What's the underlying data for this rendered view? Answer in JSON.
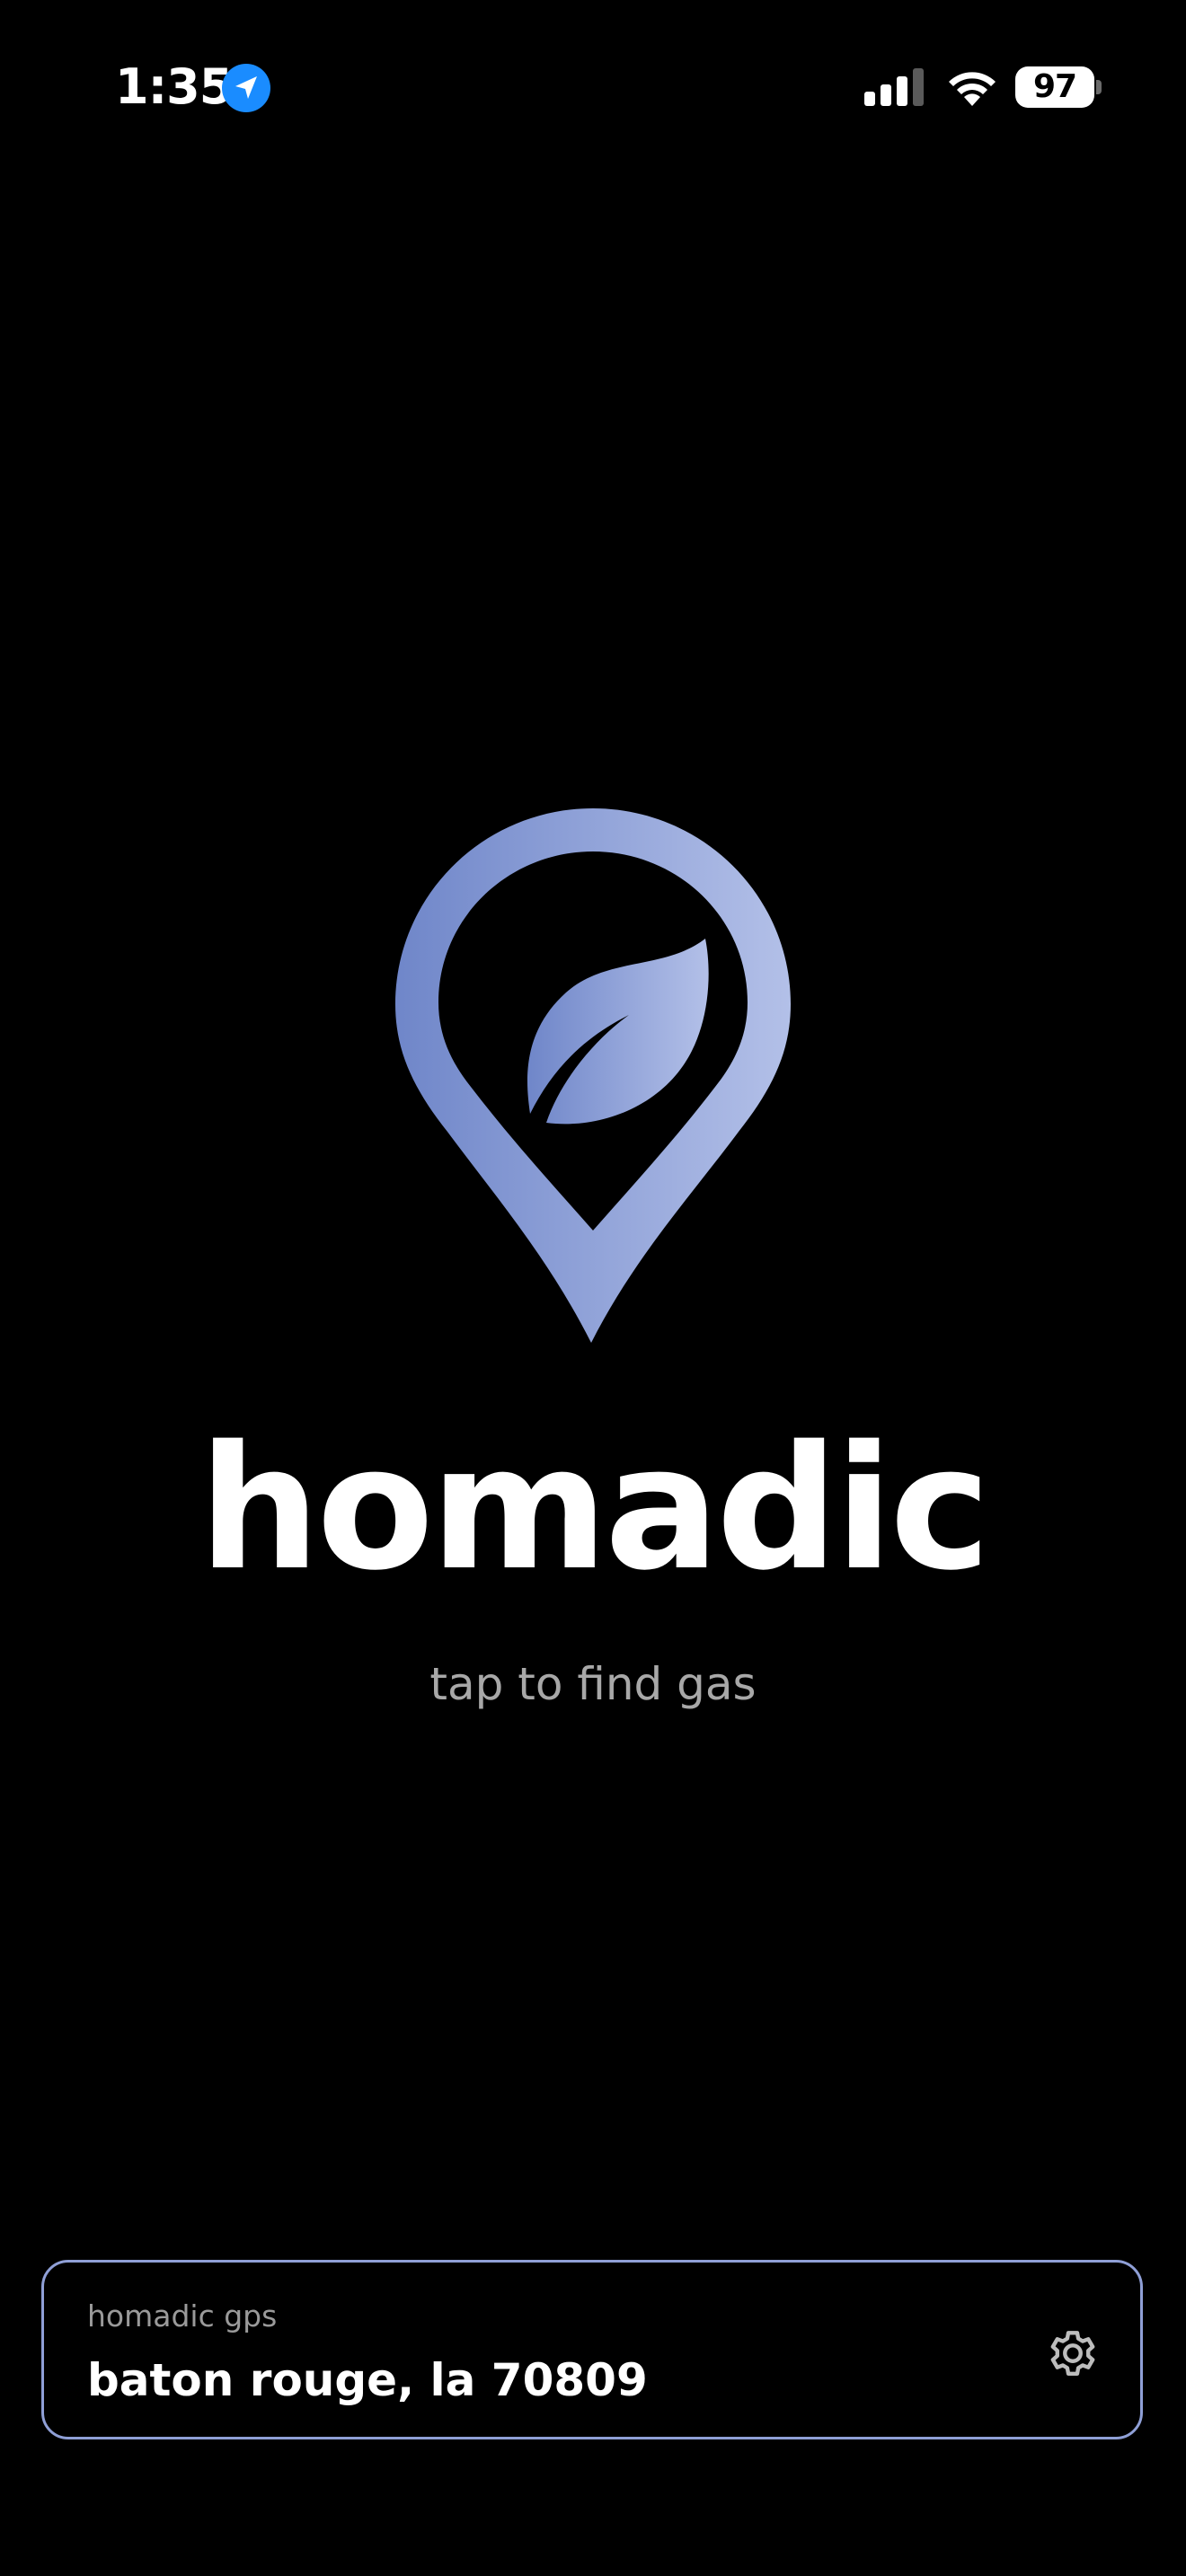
{
  "status_bar": {
    "time": "1:35",
    "location_icon": "location-arrow-icon",
    "signal_icon": "cellular-signal-icon",
    "wifi_icon": "wifi-icon",
    "battery_level": "97"
  },
  "hero": {
    "logo_icon": "map-pin-leaf-icon",
    "app_name": "homadic",
    "tagline": "tap to find gas"
  },
  "gps_card": {
    "label": "homadic gps",
    "location": "baton rouge, la 70809",
    "settings_icon": "gear-icon"
  },
  "colors": {
    "background": "#000000",
    "accent_start": "#6f86c9",
    "accent_end": "#b3c0e8",
    "location_blue": "#1a8cff"
  }
}
